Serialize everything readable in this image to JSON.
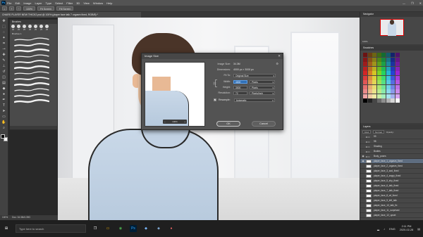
{
  "menubar": {
    "app_logo": "Ps",
    "items": [
      "File",
      "Edit",
      "Image",
      "Layer",
      "Type",
      "Select",
      "Filter",
      "3D",
      "View",
      "Window",
      "Help"
    ],
    "window_controls": [
      "—",
      "❐",
      "✕"
    ]
  },
  "optbar": {
    "zoom_value": "100%",
    "fit_screen": "Fit Screen",
    "fill_screen": "Fill Screen"
  },
  "document": {
    "tab_title": "CHARS PLAYER NEW THICK2.psd @ 100% (player face talk 7 orgasm fixed, RGB/8) *"
  },
  "brushes_panel": {
    "title": "Brushes",
    "sizes": [
      "30",
      "25",
      "25",
      "25",
      "25",
      "25",
      "25"
    ],
    "group_label": "Brushes 1"
  },
  "dialog": {
    "title": "Image Size",
    "image_size_label": "Image Size:",
    "image_size_value": "34.3M",
    "dimensions_label": "Dimensions:",
    "dimensions_value": "4000 px  ×  3000 px",
    "fit_to_label": "Fit To:",
    "fit_to_value": "Original Size",
    "width_label": "Width:",
    "width_value": "4000",
    "width_unit": "Pixels",
    "height_label": "Height:",
    "height_value": "3000",
    "height_unit": "Pixels",
    "resolution_label": "Resolution:",
    "resolution_value": "72",
    "resolution_unit": "Pixels/Inch",
    "resample_label": "Resample:",
    "resample_value": "Automatic",
    "preview_zoom": "100%",
    "ok_label": "OK",
    "cancel_label": "Cancel"
  },
  "right_panels": {
    "navigator_tabs": [
      "Navigator"
    ],
    "navigator_zoom": "100%",
    "swatches_tabs": [
      "Swatches"
    ],
    "layers_tabs": [
      "Layers"
    ],
    "layers_kind": "Kind",
    "layers_blend": "Normal",
    "layers_opacity": "Opacity:",
    "layers": [
      {
        "name": "99",
        "type": "folder",
        "visible": false,
        "selected": false
      },
      {
        "name": "98",
        "type": "folder",
        "visible": false,
        "selected": false
      },
      {
        "name": "Shading",
        "type": "folder",
        "visible": false,
        "selected": false
      },
      {
        "name": "Bodies",
        "type": "folder",
        "visible": false,
        "selected": false
      },
      {
        "name": "Body_poses",
        "type": "folder",
        "visible": true,
        "selected": false
      },
      {
        "name": "player_face_1_orgasm_fixed",
        "type": "layer",
        "visible": true,
        "selected": true
      },
      {
        "name": "player_face_2_orgasm_fixed",
        "type": "layer",
        "visible": false,
        "selected": false
      },
      {
        "name": "player_face_3_sad_fixed",
        "type": "layer",
        "visible": false,
        "selected": false
      },
      {
        "name": "player_face_4_angry_fixed",
        "type": "layer",
        "visible": false,
        "selected": false
      },
      {
        "name": "player_face_5_shy_fixed",
        "type": "layer",
        "visible": false,
        "selected": false
      },
      {
        "name": "player_face_6_talk_fixed",
        "type": "layer",
        "visible": false,
        "selected": false
      },
      {
        "name": "player_face_7_talk_fixed",
        "type": "layer",
        "visible": false,
        "selected": false
      },
      {
        "name": "player_face_8_wf_fixed",
        "type": "layer",
        "visible": false,
        "selected": false
      },
      {
        "name": "player_face_9_left_talk",
        "type": "layer",
        "visible": false,
        "selected": false
      },
      {
        "name": "player_face_10_talk_fix",
        "type": "layer",
        "visible": false,
        "selected": false
      },
      {
        "name": "player_face_11_surprised",
        "type": "layer",
        "visible": false,
        "selected": false
      },
      {
        "name": "player_face_12_upset",
        "type": "layer",
        "visible": false,
        "selected": false
      }
    ]
  },
  "statusbar": {
    "zoom": "100%",
    "doc_info": "Doc: 34.3M/4.39G"
  },
  "taskbar": {
    "search_placeholder": "Type here to search",
    "time": "2:11 PM",
    "date": "2020-02-28",
    "lang": "ENG"
  },
  "colors": {
    "ps_ui_dark": "#424242",
    "ps_panel": "#535353",
    "accent_blue": "#2f6fb6",
    "shirt": "#c9d8e8",
    "hair": "#4a3428",
    "skin": "#f0c7a5"
  }
}
